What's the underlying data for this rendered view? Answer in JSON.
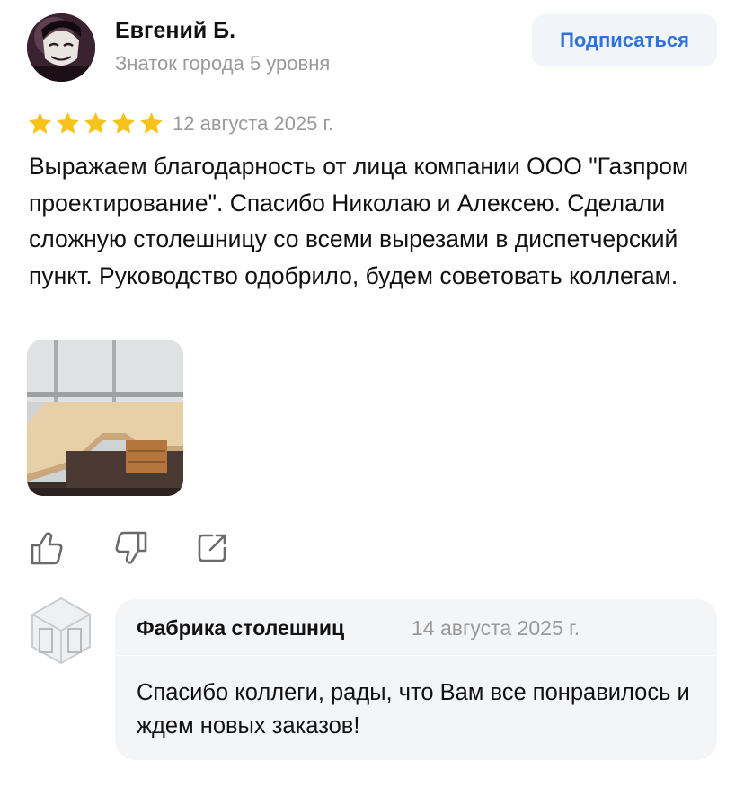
{
  "review": {
    "author": {
      "name": "Евгений Б.",
      "level": "Знаток города 5 уровня",
      "avatar": "user-avatar-photo"
    },
    "subscribe_label": "Подписаться",
    "rating": 5,
    "rating_max": 5,
    "date": "12 августа 2025 г.",
    "text": "Выражаем благодарность от лица компании ООО \"Газпром проектирование\". Спасибо Николаю и Алексею. Сделали сложную столешницу со всеми вырезами в диспетчерский пункт. Руководство одобрило, будем советовать коллегам.",
    "actions": {
      "like_icon": "thumbs-up-icon",
      "dislike_icon": "thumbs-down-icon",
      "share_icon": "share-icon"
    }
  },
  "reply": {
    "author": "Фабрика столешниц",
    "date": "14 августа 2025 г.",
    "text": "Спасибо коллеги, рады, что Вам все понравилось и ждем новых заказов!"
  },
  "colors": {
    "accent": "#2f72d9",
    "star": "#f7c31b",
    "muted": "#9a9a9a",
    "card_bg": "#f4f5f7"
  }
}
